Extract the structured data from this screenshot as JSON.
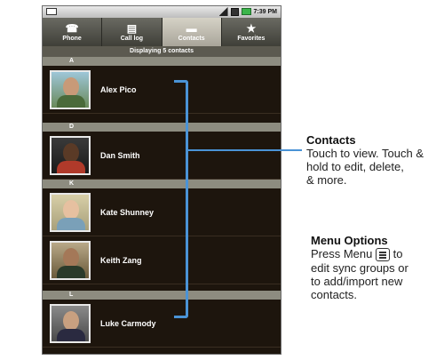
{
  "status_bar": {
    "time": "7:39 PM"
  },
  "tabs": [
    {
      "label": "Phone",
      "icon": "phone-icon",
      "glyph": "☎",
      "active": false
    },
    {
      "label": "Call log",
      "icon": "call-log-icon",
      "glyph": "▤",
      "active": false
    },
    {
      "label": "Contacts",
      "icon": "contacts-folder-icon",
      "glyph": "▬",
      "active": true
    },
    {
      "label": "Favorites",
      "icon": "star-icon",
      "glyph": "★",
      "active": false
    }
  ],
  "header": {
    "text": "Displaying 5 contacts"
  },
  "dividers": [
    "A",
    "D",
    "K",
    "L"
  ],
  "contacts": [
    {
      "name": "Alex Pico"
    },
    {
      "name": "Dan Smith"
    },
    {
      "name": "Kate Shunney"
    },
    {
      "name": "Keith Zang"
    },
    {
      "name": "Luke Carmody"
    }
  ],
  "callouts": {
    "contacts": {
      "title": "Contacts",
      "line1": "Touch to view. Touch &",
      "line2": "hold to edit, delete,",
      "line3": "& more."
    },
    "menu_options": {
      "title": "Menu Options",
      "line1_prefix": "Press Menu",
      "line1_suffix": "to",
      "line2": "edit sync groups or",
      "line3": "to add/import new",
      "line4": "contacts."
    }
  },
  "colors": {
    "accent": "#4a93d6",
    "list_bg": "#1d150d",
    "divider": "#8d8c80"
  }
}
